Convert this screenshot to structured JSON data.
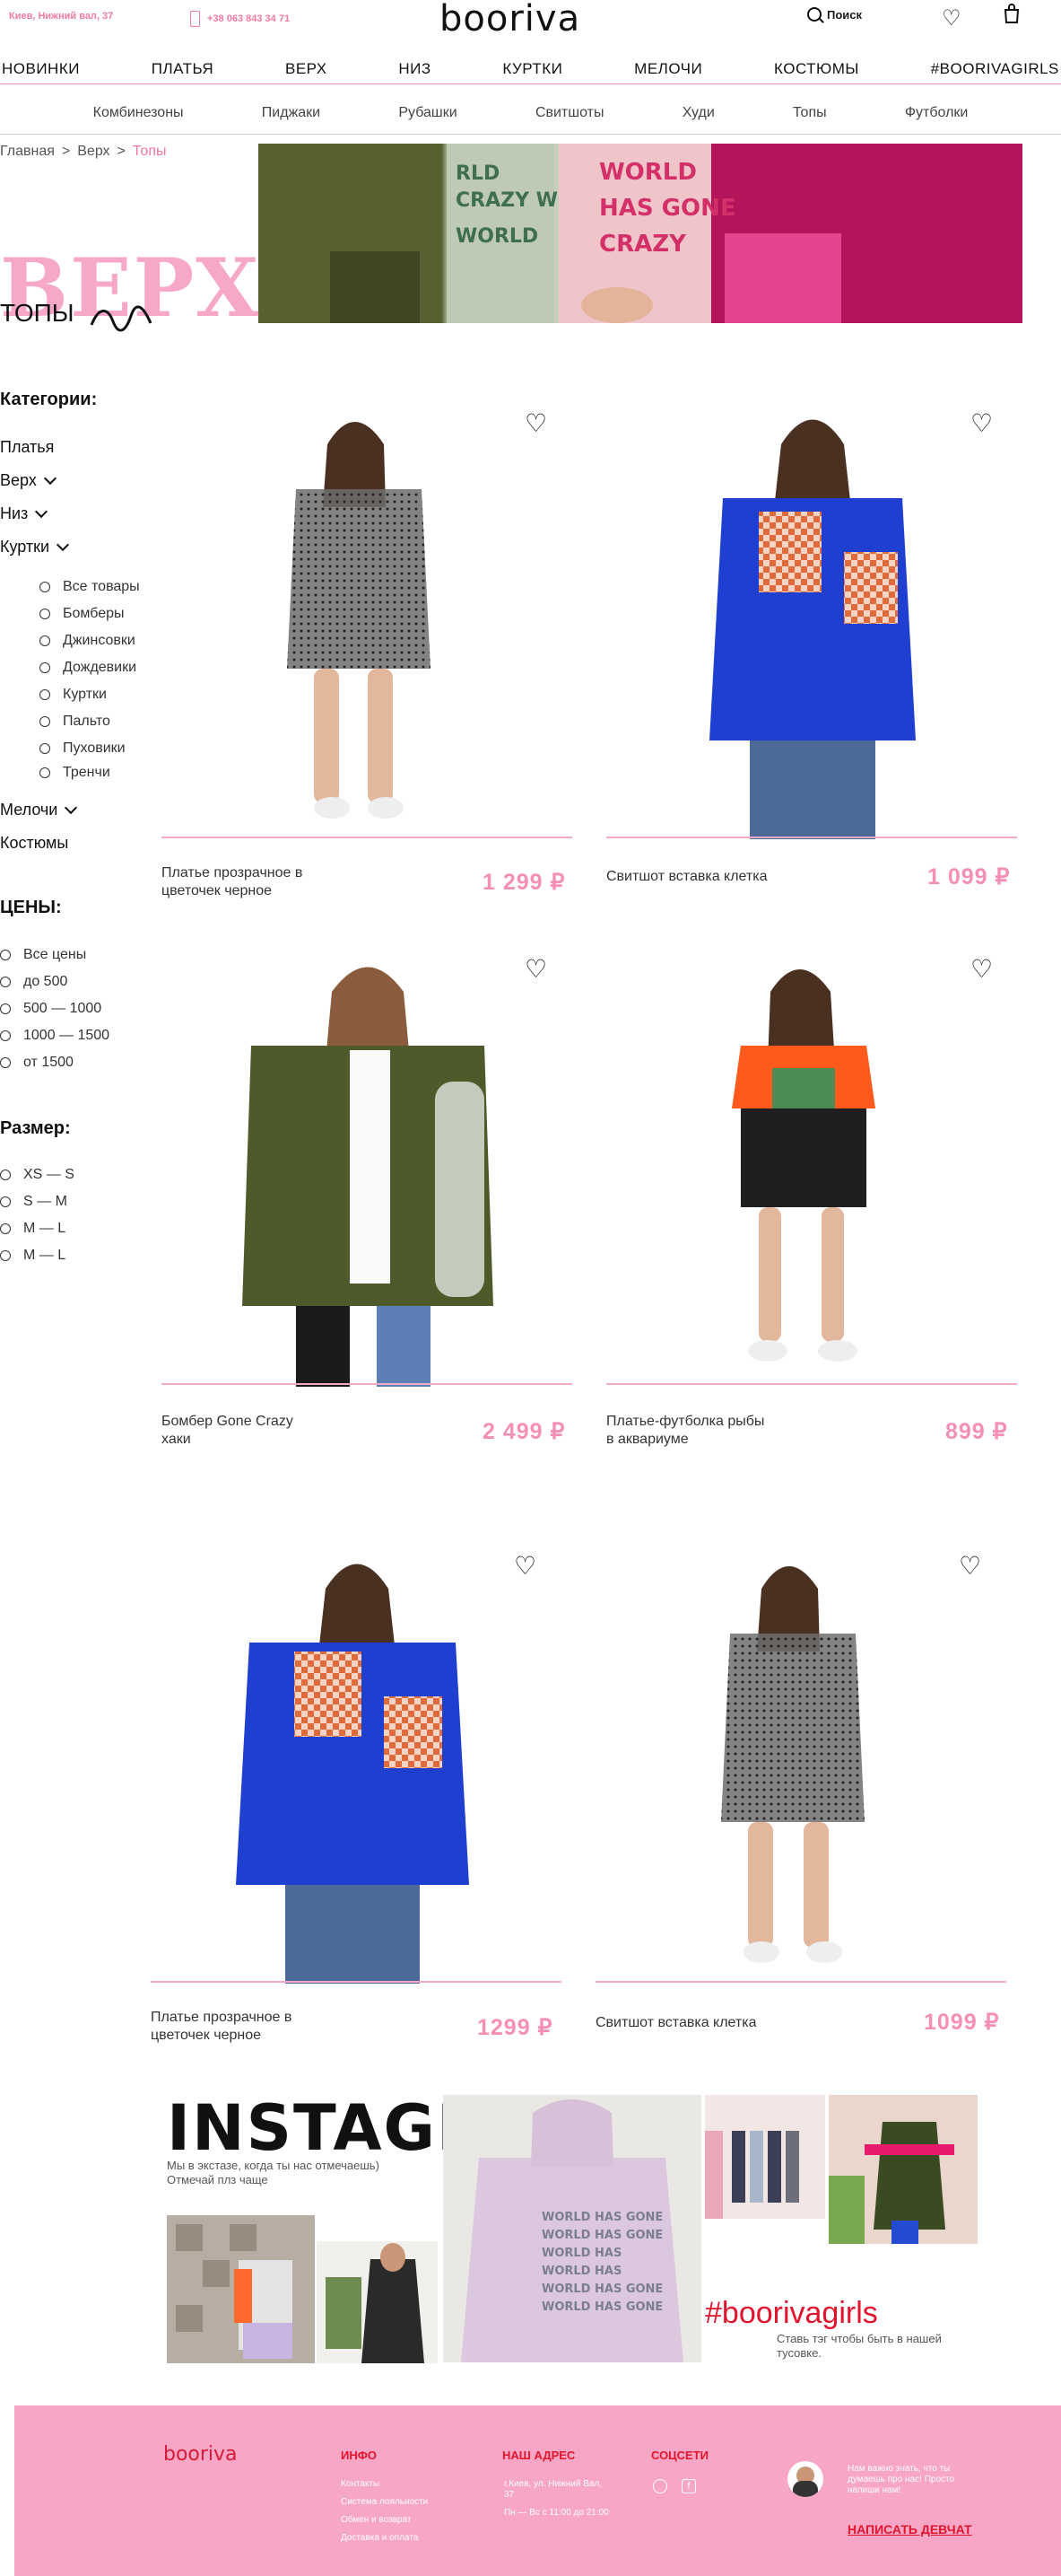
{
  "header": {
    "address": "Киев, Нижний вал, 37",
    "phone": "+38 063 843 34 71",
    "logo": "booriva",
    "search_label": "Поиск"
  },
  "main_nav": [
    "НОВИНКИ",
    "ПЛАТЬЯ",
    "ВЕРХ",
    "НИЗ",
    "КУРТКИ",
    "МЕЛОЧИ",
    "КОСТЮМЫ",
    "#BOORIVAGIRLS"
  ],
  "sub_nav": [
    "Комбинезоны",
    "Пиджаки",
    "Рубашки",
    "Свитшоты",
    "Худи",
    "Топы",
    "Футболки"
  ],
  "breadcrumb": [
    "Главная",
    "Верх",
    "Топы"
  ],
  "page": {
    "big_title": "ВЕРХ",
    "sub_title": "ТОПЫ"
  },
  "sidebar": {
    "categories_title": "Категории:",
    "categories": [
      "Платья",
      "Верх",
      "Низ",
      "Куртки",
      "Мелочи",
      "Костюмы"
    ],
    "jackets_sub": [
      "Все товары",
      "Бомберы",
      "Джинсовки",
      "Дождевики",
      "Куртки",
      "Пальто",
      "Пуховики",
      "Тренчи"
    ],
    "prices_title": "ЦЕНЫ:",
    "prices": [
      "Все цены",
      "до 500",
      "500 — 1000",
      "1000 — 1500",
      "от 1500"
    ],
    "size_title": "Размер:",
    "sizes": [
      "XS — S",
      "S — M",
      "M — L",
      "M — L"
    ]
  },
  "products": [
    {
      "name_1": "Платье прозрачное в",
      "name_2": "цветочек черное",
      "price": "1 299 ₽"
    },
    {
      "name_1": "Свитшот вставка клетка",
      "name_2": "",
      "price": "1 099 ₽"
    },
    {
      "name_1": "Бомбер Gone Crazy",
      "name_2": "хаки",
      "price": "2 499 ₽"
    },
    {
      "name_1": "Платье-футболка рыбы",
      "name_2": "в аквариуме",
      "price": "899 ₽"
    },
    {
      "name_1": "Платье прозрачное в",
      "name_2": "цветочек черное",
      "price": "1299 ₽"
    },
    {
      "name_1": "Свитшот вставка клетка",
      "name_2": "",
      "price": "1099 ₽"
    }
  ],
  "instagram": {
    "title": "INSTAGRAM",
    "subtitle": "Мы в экстазе, когда ты нас отмечаешь) Отмечай плз чаще",
    "hashtag": "#boorivagirls",
    "hashtag_sub": "Ставь тэг чтобы быть в нашей тусовке."
  },
  "footer": {
    "logo": "booriva",
    "info_title": "ИНФО",
    "info_links": [
      "Контакты",
      "Система лояльности",
      "Обмен и возврат",
      "Доставка и оплата"
    ],
    "address_title": "НАШ АДРЕС",
    "address_line1": "г.Киев, ул. Нижний Вал,",
    "address_line2": "37",
    "hours": "Пн — Вс с 11:00 до 21:00",
    "social_title": "СОЦСЕТИ",
    "cta": "Нам важно знать, что ты думаешь про нас! Просто напиши нам!",
    "cta_button": "НАПИСАТЬ ДЕВЧАТ"
  },
  "colors": {
    "accent_pink": "#f58fb6",
    "footer_pink": "#f7a7c5",
    "red": "#e3132e"
  }
}
